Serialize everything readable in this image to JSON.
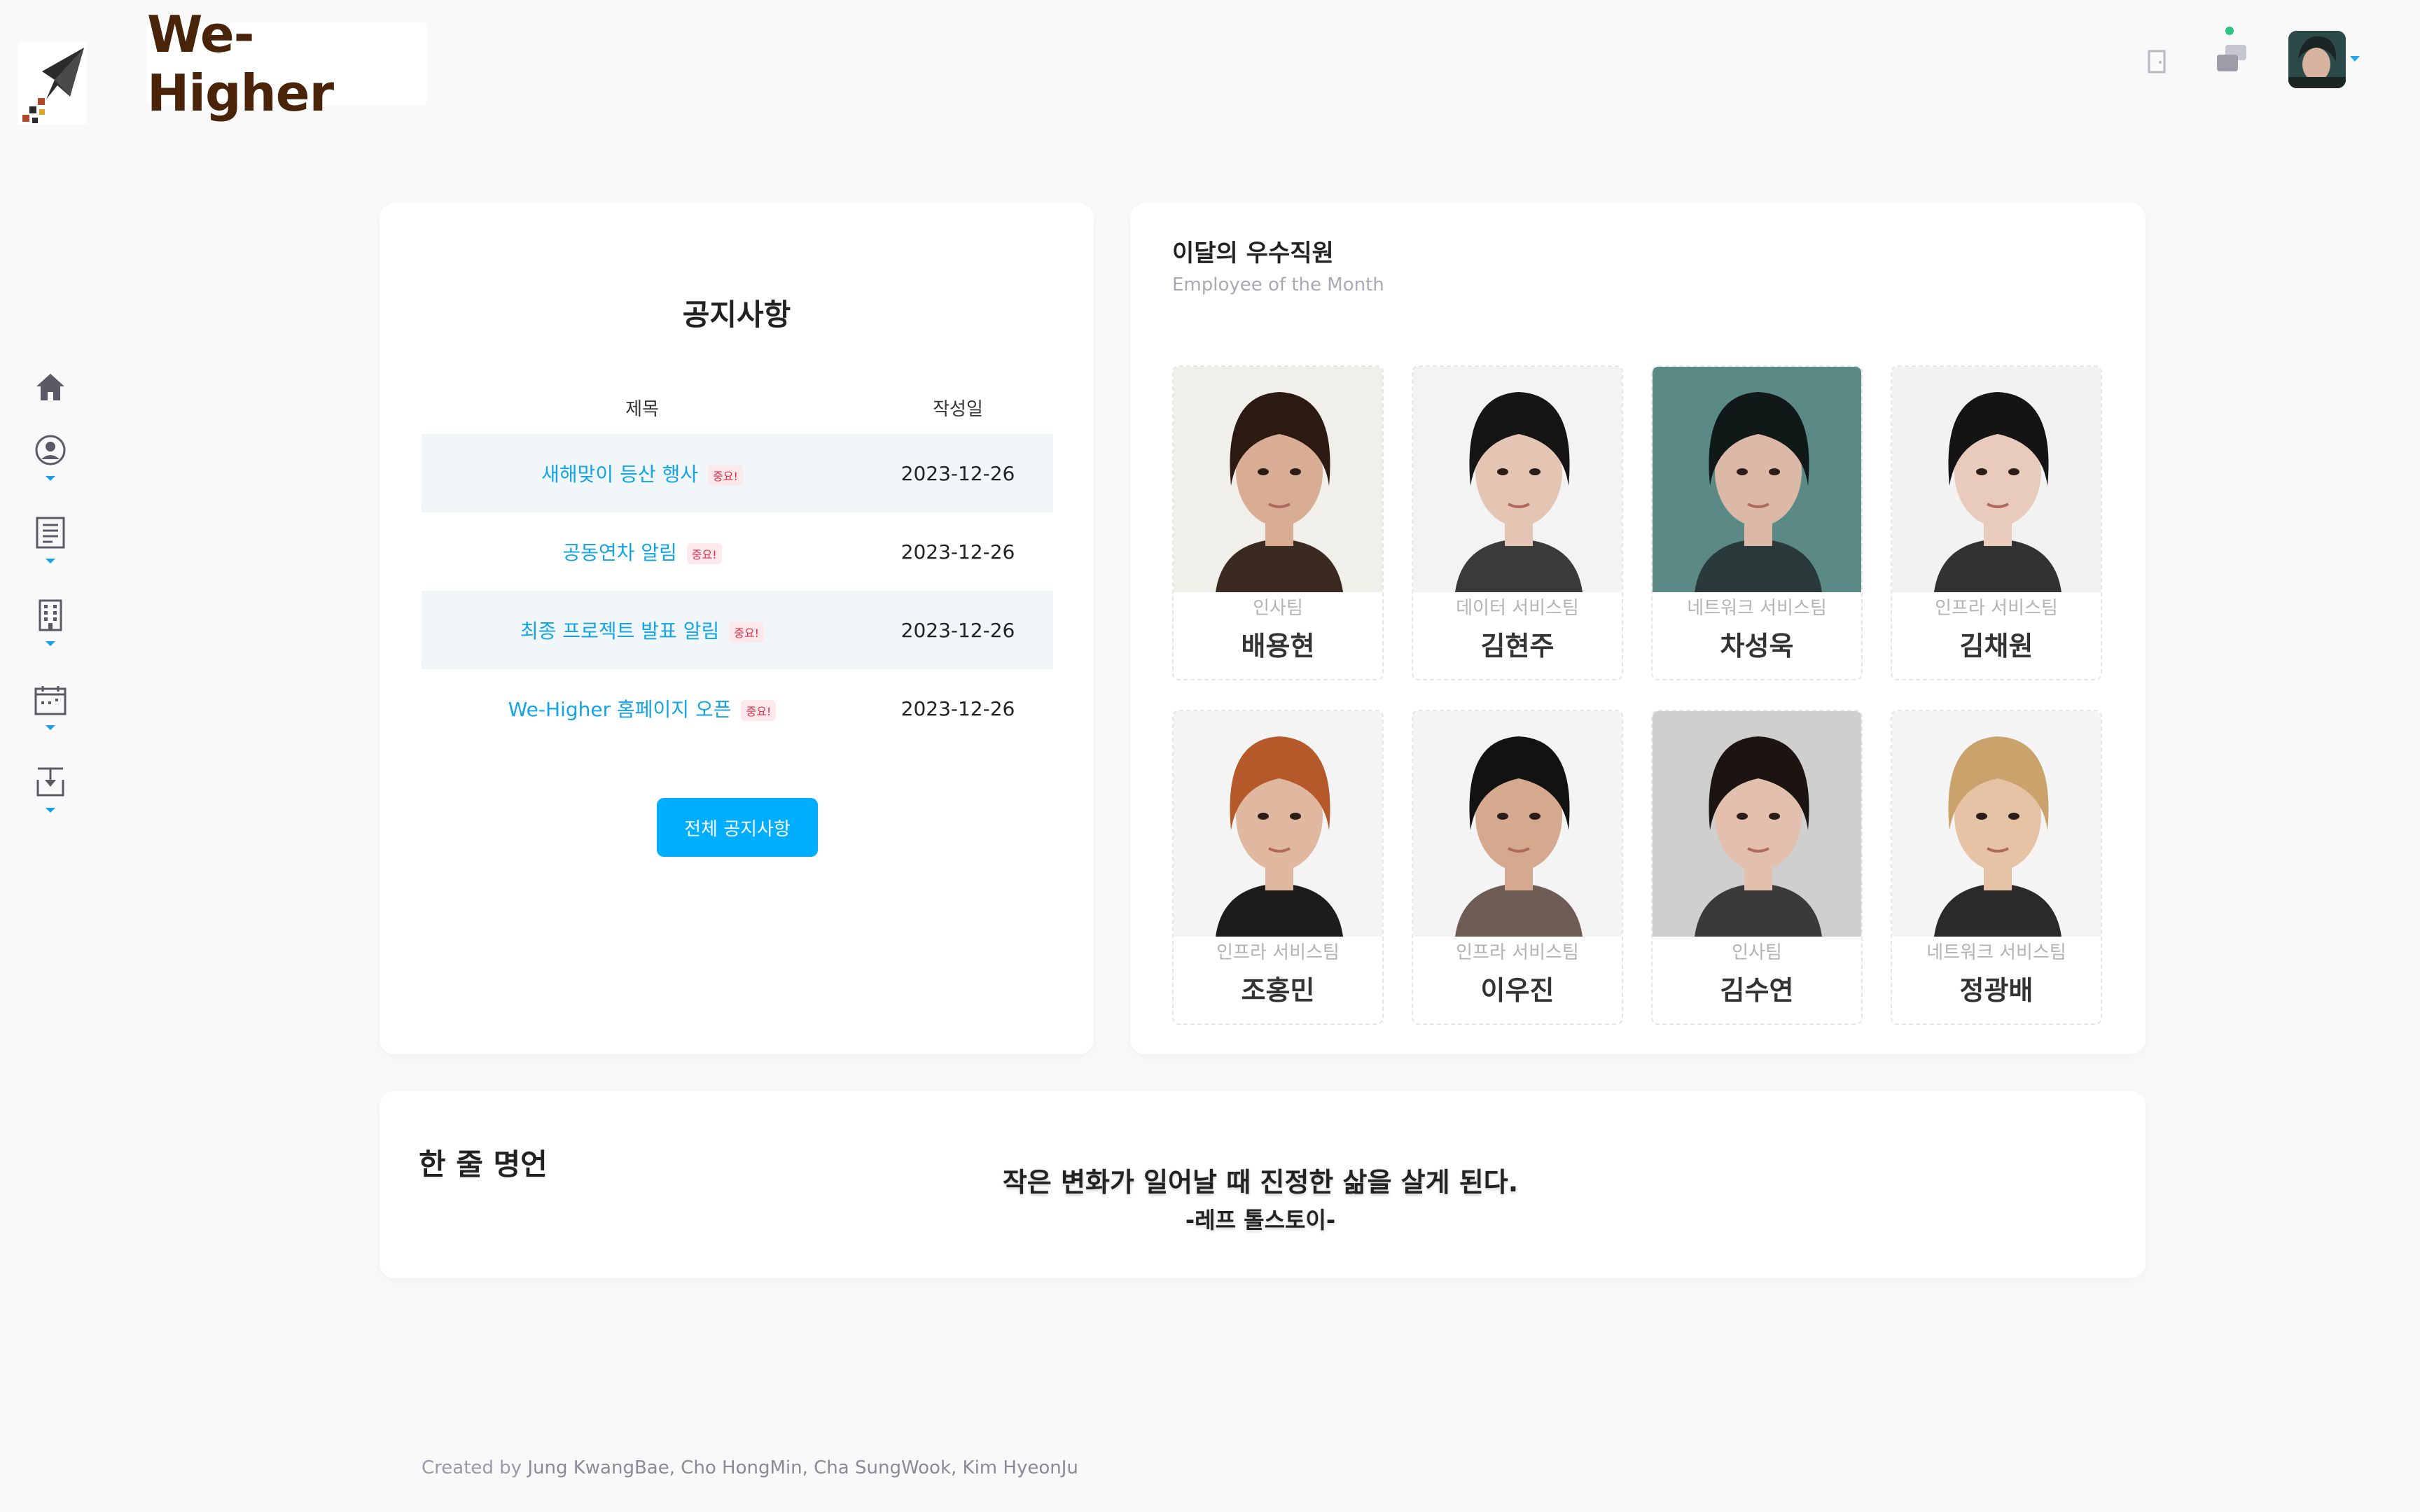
{
  "brand": {
    "name": "We-Higher",
    "logo_icon": "paper-plane-icon"
  },
  "header": {
    "exit_icon": "exit-door-icon",
    "message_icon": "chat-bubbles-icon",
    "status_color": "#2fc282",
    "avatar_alt": "user-avatar"
  },
  "sidebar": {
    "items": [
      {
        "icon": "home-icon"
      },
      {
        "icon": "user-circle-icon"
      },
      {
        "icon": "document-icon"
      },
      {
        "icon": "building-icon"
      },
      {
        "icon": "calendar-icon"
      },
      {
        "icon": "download-box-icon"
      }
    ],
    "accent": "#1aa0e6"
  },
  "notice": {
    "title": "공지사항",
    "col_title": "제목",
    "col_date": "작성일",
    "rows": [
      {
        "title": "새해맞이 등산 행사",
        "badge": "중요!",
        "date": "2023-12-26"
      },
      {
        "title": "공동연차 알림",
        "badge": "중요!",
        "date": "2023-12-26"
      },
      {
        "title": "최종 프로젝트 발표 알림",
        "badge": "중요!",
        "date": "2023-12-26"
      },
      {
        "title": "We-Higher 홈페이지 오픈",
        "badge": "중요!",
        "date": "2023-12-26"
      }
    ],
    "button": "전체 공지사항",
    "accent": "#00aeff"
  },
  "employees": {
    "title": "이달의 우수직원",
    "subtitle": "Employee of the Month",
    "list": [
      {
        "team": "인사팀",
        "name": "배용현"
      },
      {
        "team": "데이터 서비스팀",
        "name": "김현주"
      },
      {
        "team": "네트워크 서비스팀",
        "name": "차성욱"
      },
      {
        "team": "인프라 서비스팀",
        "name": "김채원"
      },
      {
        "team": "인프라 서비스팀",
        "name": "조홍민"
      },
      {
        "team": "인프라 서비스팀",
        "name": "이우진"
      },
      {
        "team": "인사팀",
        "name": "김수연"
      },
      {
        "team": "네트워크 서비스팀",
        "name": "정광배"
      }
    ]
  },
  "quote": {
    "label": "한 줄 명언",
    "text": "작은 변화가 일어날 때 진정한 삶을 살게 된다.",
    "author": "-레프 톨스토이-"
  },
  "footer": {
    "prefix": "Created by ",
    "names": "Jung KwangBae, Cho HongMin, Cha SungWook, Kim HyeonJu"
  }
}
